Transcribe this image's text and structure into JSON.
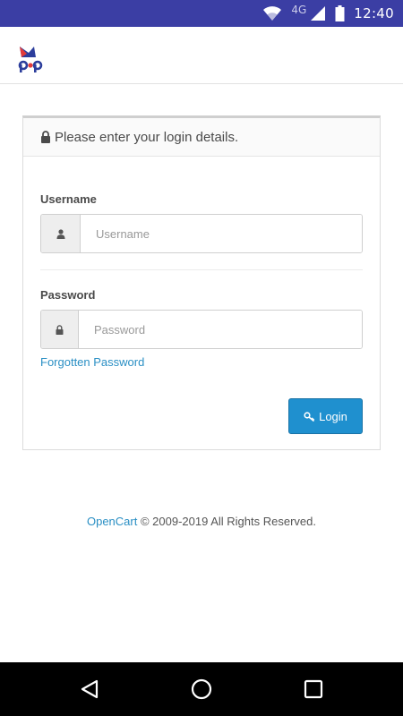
{
  "status_bar": {
    "time": "12:40",
    "network": "4G",
    "icons": [
      "wifi-icon",
      "signal-icon",
      "battery-icon"
    ]
  },
  "header": {
    "logo": "pop-logo"
  },
  "login_panel": {
    "heading": "Please enter your login details.",
    "username": {
      "label": "Username",
      "placeholder": "Username",
      "value": "",
      "icon": "user-icon"
    },
    "password": {
      "label": "Password",
      "placeholder": "Password",
      "value": "",
      "icon": "lock-icon"
    },
    "forgot_link": "Forgotten Password",
    "login_button": "Login",
    "login_icon": "key-icon"
  },
  "footer": {
    "brand_link": "OpenCart",
    "copyright": " © 2009-2019 All Rights Reserved."
  },
  "nav_bar": {
    "buttons": [
      "back-icon",
      "home-icon",
      "recents-icon"
    ]
  },
  "colors": {
    "status_bar": "#3b3ea4",
    "accent": "#1f90cf",
    "link": "#2a8fc4"
  }
}
